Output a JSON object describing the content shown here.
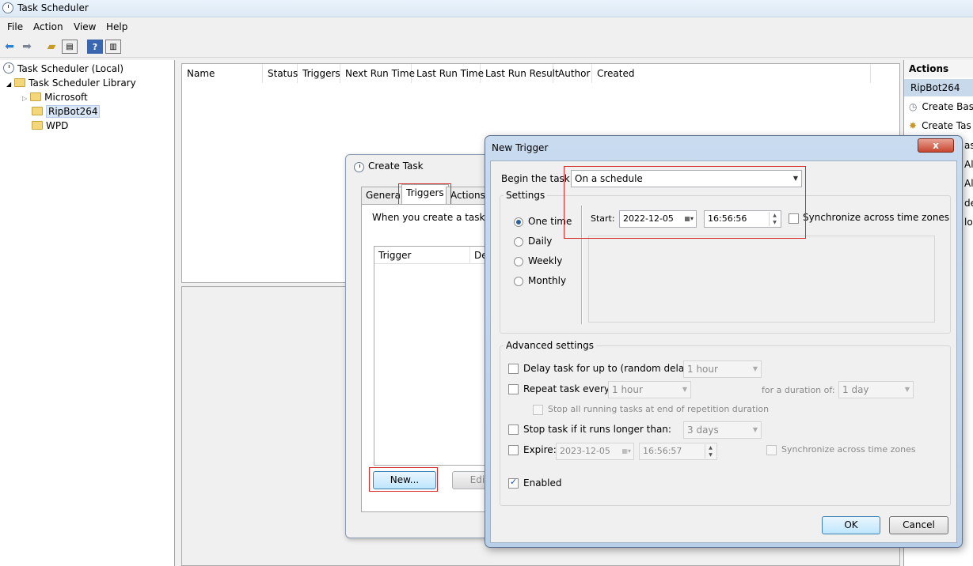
{
  "app": {
    "title": "Task Scheduler"
  },
  "menu": [
    "File",
    "Action",
    "View",
    "Help"
  ],
  "tree": {
    "root": "Task Scheduler (Local)",
    "library": "Task Scheduler Library",
    "children": [
      "Microsoft",
      "RipBot264",
      "WPD"
    ]
  },
  "columns": [
    "Name",
    "Status",
    "Triggers",
    "Next Run Time",
    "Last Run Time",
    "Last Run Result",
    "Author",
    "Created"
  ],
  "actions_pane": {
    "header": "Actions",
    "subheader": "RipBot264",
    "items": [
      "Create Bas",
      "Create Tas",
      "as",
      "All",
      "All T",
      "de",
      "lo"
    ]
  },
  "create_task": {
    "title": "Create Task",
    "tabs": [
      "General",
      "Triggers",
      "Actions"
    ],
    "description": "When you create a task, yo",
    "trigger_columns": [
      "Trigger",
      "De"
    ],
    "new_button": "New...",
    "edit_button": "Edit..."
  },
  "new_trigger": {
    "title": "New Trigger",
    "close": "x",
    "begin_label": "Begin the task:",
    "begin_value": "On a schedule",
    "settings_label": "Settings",
    "schedule_options": [
      "One time",
      "Daily",
      "Weekly",
      "Monthly"
    ],
    "start_label": "Start:",
    "start_date": "2022-12-05",
    "start_time": "16:56:56",
    "sync_label": "Synchronize across time zones",
    "advanced_label": "Advanced settings",
    "delay_label": "Delay task for up to (random delay):",
    "delay_value": "1 hour",
    "repeat_label": "Repeat task every:",
    "repeat_value": "1 hour",
    "duration_label": "for a duration of:",
    "duration_value": "1 day",
    "stop_all_label": "Stop all running tasks at end of repetition duration",
    "stop_longer_label": "Stop task if it runs longer than:",
    "stop_longer_value": "3 days",
    "expire_label": "Expire:",
    "expire_date": "2023-12-05",
    "expire_time": "16:56:57",
    "expire_sync_label": "Synchronize across time zones",
    "enabled_label": "Enabled",
    "ok": "OK",
    "cancel": "Cancel"
  }
}
